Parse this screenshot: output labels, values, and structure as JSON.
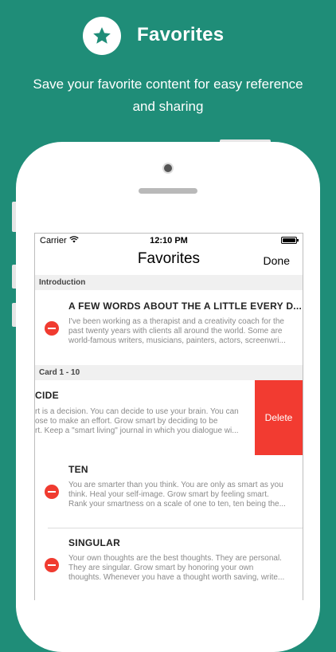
{
  "promo": {
    "title": "Favorites",
    "subtitle_line1": "Save your favorite content for easy reference",
    "subtitle_line2": "and sharing"
  },
  "status_bar": {
    "carrier": "Carrier",
    "time": "12:10 PM"
  },
  "nav": {
    "title": "Favorites",
    "done_label": "Done"
  },
  "sections": [
    {
      "header": "Introduction"
    },
    {
      "header": "Card 1 - 10"
    }
  ],
  "rows": [
    {
      "title": "A FEW WORDS ABOUT THE A LITTLE EVERY D...",
      "lines": [
        "I've been working as a therapist and a creativity coach for the",
        "past twenty years with clients all around the world. Some are",
        "world-famous writers, musicians, painters, actors, screenwri..."
      ]
    },
    {
      "title": "CIDE",
      "lines": [
        "rt is a decision. You can decide to use your brain. You can",
        "ose to make an effort. Grow smart by deciding to be",
        "rt. Keep a \"smart living\" journal in which you dialogue wi..."
      ],
      "delete_label": "Delete"
    },
    {
      "title": "TEN",
      "lines": [
        "You are smarter than you think. You are only as smart as you",
        "think. Heal your self-image. Grow smart by feeling smart.",
        "Rank your smartness on a scale of one to ten, ten being the..."
      ]
    },
    {
      "title": "SINGULAR",
      "lines": [
        "Your own thoughts are the best thoughts. They are personal.",
        "They are singular. Grow smart by honoring your own",
        "thoughts. Whenever you have a thought worth saving, write..."
      ]
    }
  ],
  "colors": {
    "background": "#1f8d78",
    "delete": "#f23b31",
    "minus": "#f03b30"
  },
  "icons": [
    "star-icon",
    "wifi-icon",
    "battery-icon",
    "minus-circle-icon"
  ]
}
